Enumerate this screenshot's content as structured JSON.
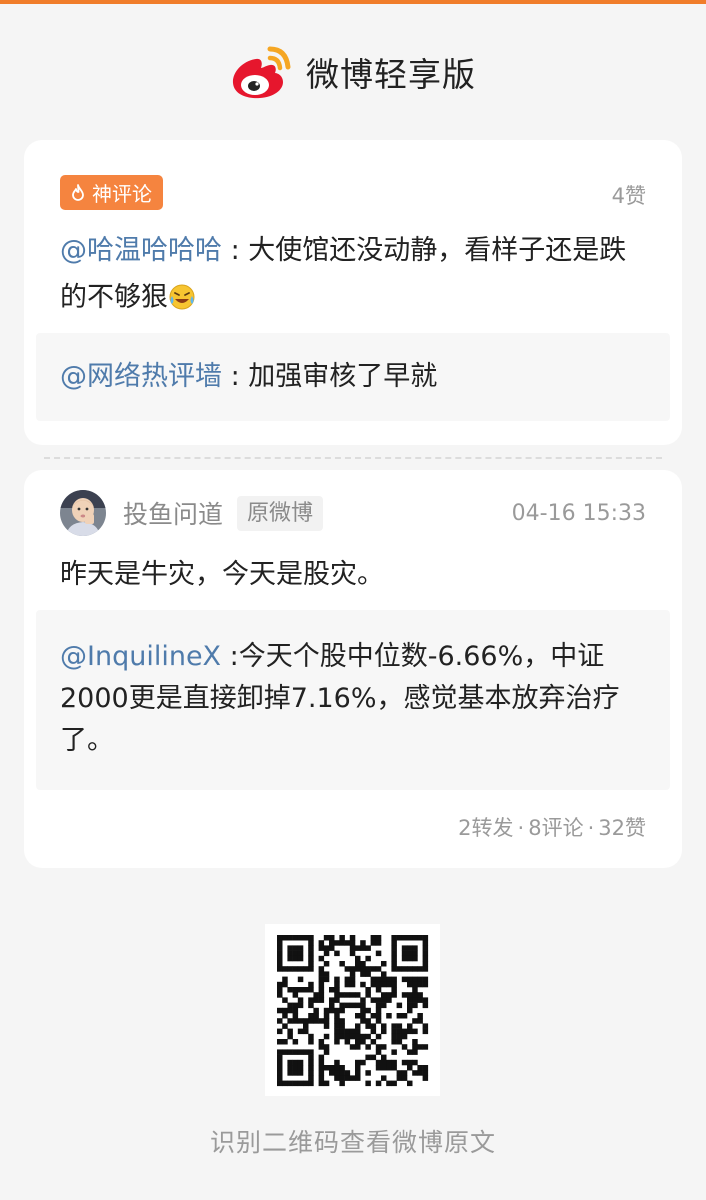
{
  "colors": {
    "accent": "#f07d2a",
    "badge": "#f5843f",
    "mention": "#4f7bab",
    "muted": "#9a9a9a",
    "card": "#ffffff",
    "background": "#f5f5f5"
  },
  "header": {
    "logo_icon": "weibo-logo",
    "app_title": "微博轻享版"
  },
  "hot_comment": {
    "badge_icon": "flame-icon",
    "badge_label": "神评论",
    "likes": "4赞",
    "author_mention": "@哈温哈哈哈",
    "separator": " : ",
    "text": "大使馆还没动静，看样子还是跌的不够狠",
    "emoji": "laughing-crying-emoji",
    "reply": {
      "author_mention": "@网络热评墙",
      "separator": " : ",
      "text": "加强审核了早就"
    }
  },
  "post": {
    "avatar_icon": "user-avatar",
    "author": "投鱼问道",
    "badge": "原微博",
    "timestamp": "04-16 15:33",
    "text": "昨天是牛灾，今天是股灾。",
    "quote": {
      "author_mention": "@InquilineX",
      "separator": " :",
      "text": "今天个股中位数-6.66%，中证2000更是直接卸掉7.16%，感觉基本放弃治疗了。"
    },
    "stats": {
      "reposts": "2转发",
      "comments": "8评论",
      "likes": "32赞",
      "dot": "·"
    }
  },
  "footer": {
    "qr_icon": "qr-code",
    "caption": "识别二维码查看微博原文"
  }
}
